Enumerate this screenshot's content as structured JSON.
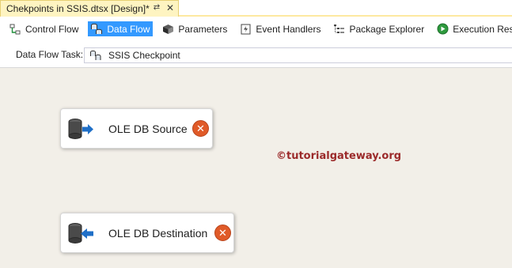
{
  "document_tab": {
    "title": "Chekpoints in SSIS.dtsx [Design]*",
    "pin_icon": "pin-icon",
    "close_icon": "close-icon"
  },
  "designer_tabs": [
    {
      "label": "Control Flow",
      "icon": "control-flow-icon",
      "active": false
    },
    {
      "label": "Data Flow",
      "icon": "data-flow-icon",
      "active": true
    },
    {
      "label": "Parameters",
      "icon": "parameters-icon",
      "active": false
    },
    {
      "label": "Event Handlers",
      "icon": "event-handlers-icon",
      "active": false
    },
    {
      "label": "Package Explorer",
      "icon": "package-explorer-icon",
      "active": false
    },
    {
      "label": "Execution Results",
      "icon": "execution-results-icon",
      "active": false
    }
  ],
  "task_row": {
    "label": "Data Flow Task:",
    "selected_task": "SSIS Checkpoint"
  },
  "components": [
    {
      "label": "OLE DB Source",
      "icon": "ole-db-source-icon",
      "status": "error"
    },
    {
      "label": "OLE DB Destination",
      "icon": "ole-db-destination-icon",
      "status": "error"
    }
  ],
  "watermark": "©tutorialgateway.org",
  "colors": {
    "active_tab": "#3399ff",
    "document_tab": "#fef4c1",
    "canvas": "#f2efe8",
    "error": "#e05a28",
    "watermark": "#9b2a2a",
    "arrow": "#1f6fc7"
  }
}
